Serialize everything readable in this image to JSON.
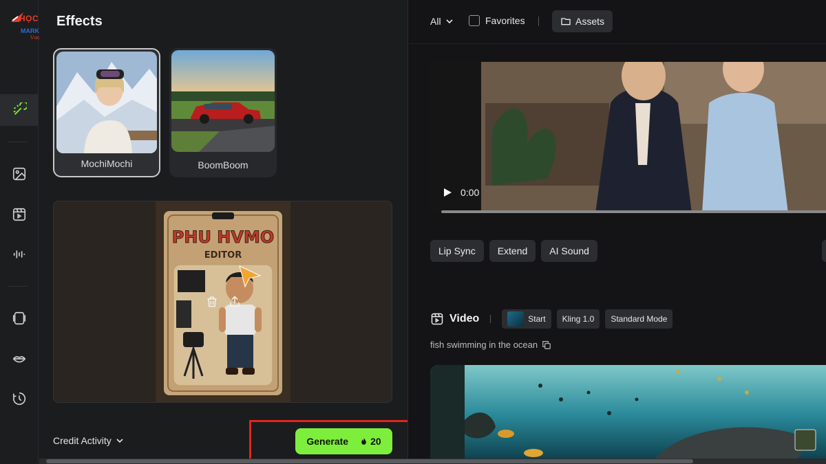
{
  "brand": {
    "line1": "HỌC VIỆN",
    "line2": "MARKETING ONLINE",
    "line3": "Vươn Xa Cùng Bạn"
  },
  "header": {
    "title": "Effects"
  },
  "rail": {
    "items": [
      {
        "icon": "effects-icon",
        "active": true
      },
      {
        "icon": "image-icon",
        "active": false
      },
      {
        "icon": "video-icon",
        "active": false
      },
      {
        "icon": "audio-icon",
        "active": false
      },
      {
        "icon": "frame-icon",
        "active": false
      },
      {
        "icon": "lips-icon",
        "active": false
      },
      {
        "icon": "history-icon",
        "active": false
      }
    ]
  },
  "effects": [
    {
      "label": "MochiMochi",
      "selected": true
    },
    {
      "label": "BoomBoom",
      "selected": false
    }
  ],
  "preview": {
    "toy_title": "PHU HVMO",
    "toy_subtitle": "EDITOR"
  },
  "footer": {
    "credit_label": "Credit Activity",
    "generate_label": "Generate",
    "generate_cost": "20"
  },
  "topbar": {
    "filter_label": "All",
    "favorites_label": "Favorites",
    "assets_label": "Assets"
  },
  "player": {
    "time": "0:00"
  },
  "actions": [
    {
      "label": "Lip Sync"
    },
    {
      "label": "Extend"
    },
    {
      "label": "AI Sound"
    }
  ],
  "video_item": {
    "title": "Video",
    "chips": [
      "Start",
      "Kling 1.0",
      "Standard Mode"
    ],
    "prompt": "fish swimming in the ocean"
  },
  "colors": {
    "accent_green": "#7dee3b",
    "highlight_red": "#e3241c"
  }
}
